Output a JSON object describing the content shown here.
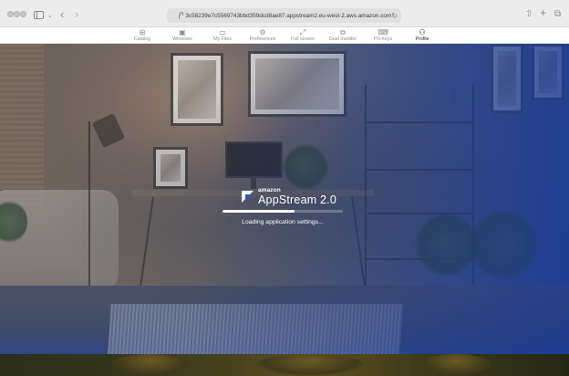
{
  "browser": {
    "url": "3c58239e7c5569743bbd359dcd8ae87.appstream2.eu-west-2.aws.amazon.com"
  },
  "toolbar": {
    "items": [
      {
        "label": "Catalog",
        "icon": "catalog-icon",
        "glyph": "⊞",
        "active": false
      },
      {
        "label": "Windows",
        "icon": "windows-icon",
        "glyph": "▣",
        "active": false
      },
      {
        "label": "My Files",
        "icon": "folder-icon",
        "glyph": "▭",
        "active": false
      },
      {
        "label": "Preferences",
        "icon": "gear-icon",
        "glyph": "⚙",
        "active": false
      },
      {
        "label": "Full screen",
        "icon": "fullscreen-icon",
        "glyph": "⤢",
        "active": false
      },
      {
        "label": "Dual monitor",
        "icon": "dual-monitor-icon",
        "glyph": "⧉",
        "active": false
      },
      {
        "label": "FN Keys",
        "icon": "fn-keys-icon",
        "glyph": "⌨",
        "active": false
      },
      {
        "label": "Profile",
        "icon": "profile-icon",
        "glyph": "⚇",
        "active": true
      }
    ]
  },
  "loader": {
    "brand_prefix": "amazon",
    "brand_name": "AppStream 2.0",
    "progress": 0.6,
    "status": "Loading application settings..."
  },
  "colors": {
    "accent": "#3a56a3",
    "progress_track": "#8a93ad",
    "progress_fill": "#ffffff"
  }
}
